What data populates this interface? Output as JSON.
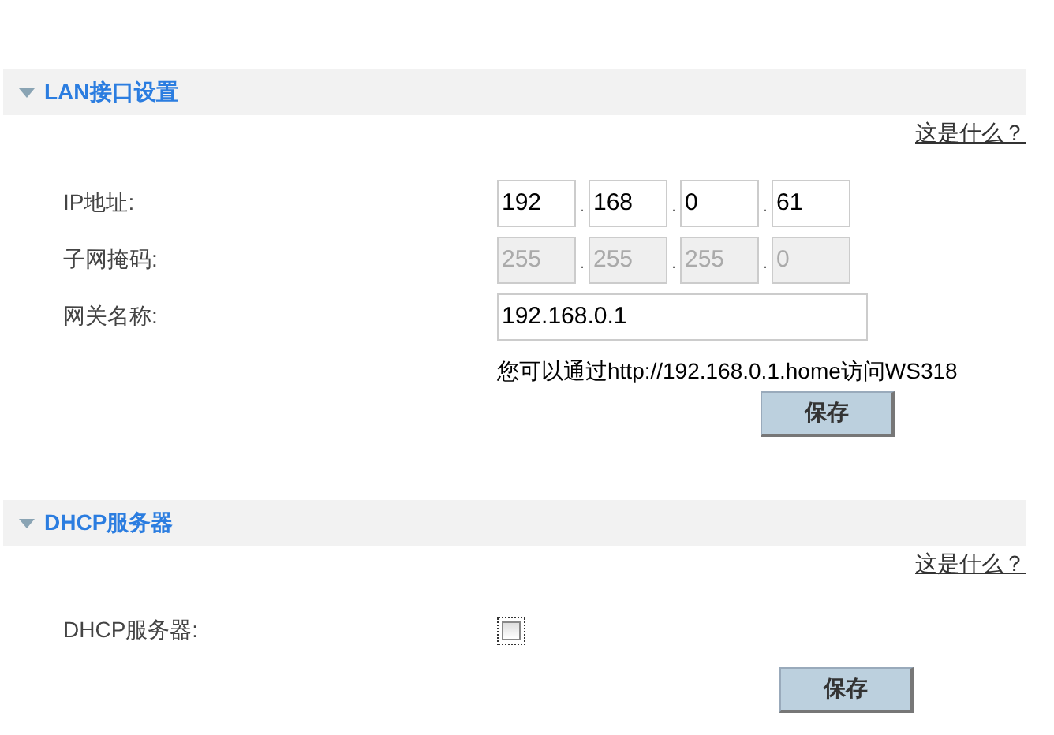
{
  "sections": [
    {
      "title": "LAN接口设置",
      "expanded": true,
      "help_link": "这是什么？",
      "rows": [
        {
          "kind": "ip",
          "label": "IP地址:",
          "disabled": false,
          "separator": ".",
          "octets": [
            "192",
            "168",
            "0",
            "61"
          ]
        },
        {
          "kind": "ip",
          "label": "子网掩码:",
          "disabled": true,
          "separator": ".",
          "octets": [
            "255",
            "255",
            "255",
            "0"
          ]
        },
        {
          "kind": "text",
          "label": "网关名称:",
          "value": "192.168.0.1"
        }
      ],
      "note": "您可以通过http://192.168.0.1.home访问WS318",
      "save": "保存"
    },
    {
      "title": "DHCP服务器",
      "expanded": true,
      "help_link": "这是什么？",
      "rows": [
        {
          "kind": "checkbox",
          "label": "DHCP服务器:",
          "checked": false
        }
      ],
      "save": "保存"
    }
  ]
}
